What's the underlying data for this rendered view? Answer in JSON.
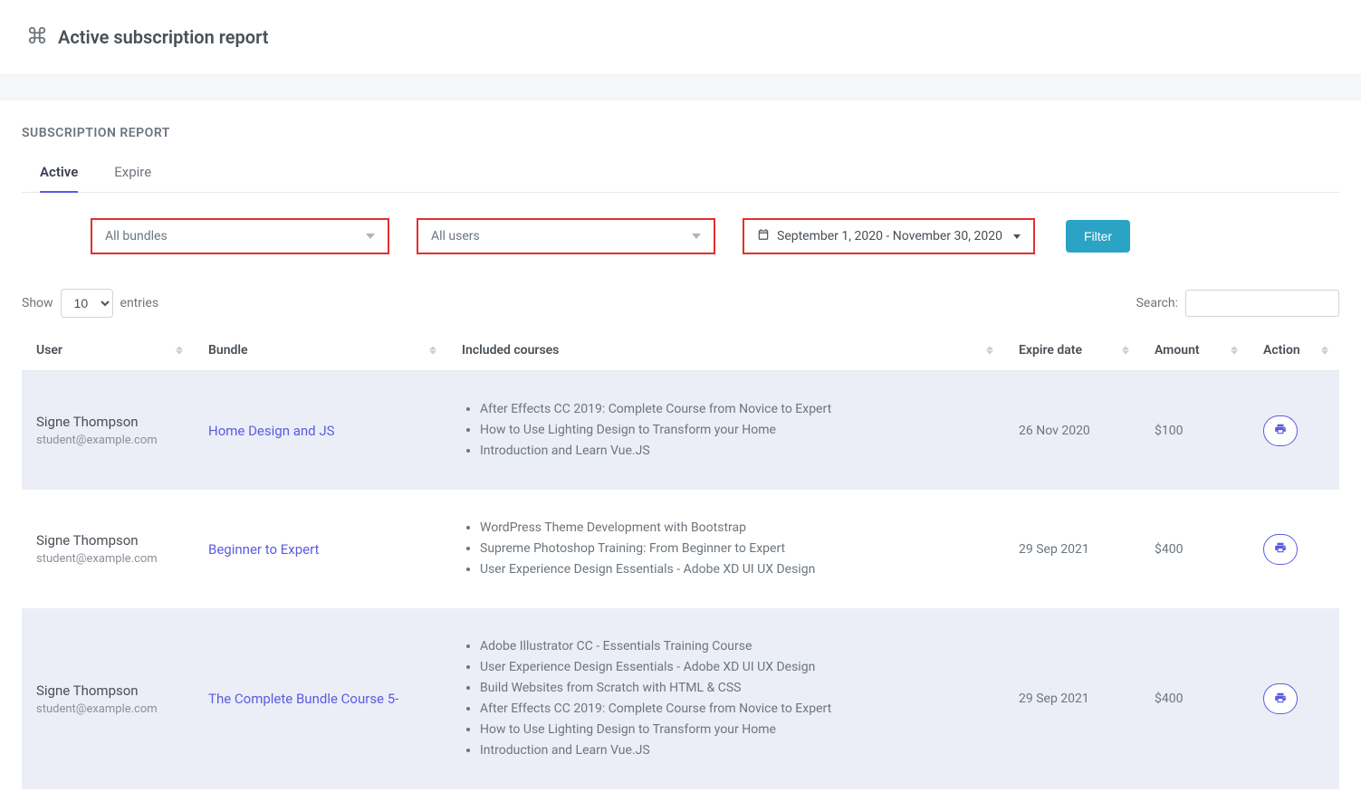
{
  "header": {
    "title": "Active subscription report"
  },
  "card": {
    "title": "SUBSCRIPTION REPORT"
  },
  "tabs": {
    "active": "Active",
    "expire": "Expire"
  },
  "filters": {
    "bundles_label": "All bundles",
    "users_label": "All users",
    "date_range": "September 1, 2020 - November 30, 2020",
    "filter_button": "Filter"
  },
  "table_controls": {
    "show_label": "Show",
    "entries_label": "entries",
    "entries_value": "10",
    "search_label": "Search:"
  },
  "columns": {
    "user": "User",
    "bundle": "Bundle",
    "courses": "Included courses",
    "expire": "Expire date",
    "amount": "Amount",
    "action": "Action"
  },
  "rows": [
    {
      "user_name": "Signe Thompson",
      "user_email": "student@example.com",
      "bundle": "Home Design and JS",
      "courses": [
        "After Effects CC 2019: Complete Course from Novice to Expert",
        "How to Use Lighting Design to Transform your Home",
        "Introduction and Learn Vue.JS"
      ],
      "expire": "26 Nov 2020",
      "amount": "$100"
    },
    {
      "user_name": "Signe Thompson",
      "user_email": "student@example.com",
      "bundle": "Beginner to Expert",
      "courses": [
        "WordPress Theme Development with Bootstrap",
        "Supreme Photoshop Training: From Beginner to Expert",
        "User Experience Design Essentials - Adobe XD UI UX Design"
      ],
      "expire": "29 Sep 2021",
      "amount": "$400"
    },
    {
      "user_name": "Signe Thompson",
      "user_email": "student@example.com",
      "bundle": "The Complete Bundle Course 5-",
      "courses": [
        "Adobe Illustrator CC - Essentials Training Course",
        "User Experience Design Essentials - Adobe XD UI UX Design",
        "Build Websites from Scratch with HTML & CSS",
        "After Effects CC 2019: Complete Course from Novice to Expert",
        "How to Use Lighting Design to Transform your Home",
        "Introduction and Learn Vue.JS"
      ],
      "expire": "29 Sep 2021",
      "amount": "$400"
    }
  ]
}
